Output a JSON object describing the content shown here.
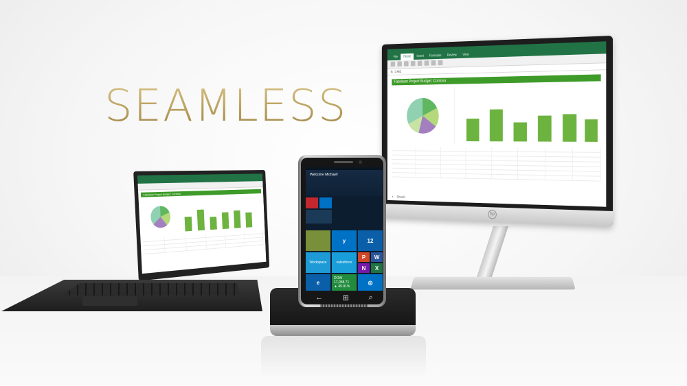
{
  "headline": "SEAMLESS",
  "monitor": {
    "sheet_title": "Fabrikam Project Budget: Contoso",
    "tabs": [
      "File",
      "Home",
      "Insert",
      "Formulas",
      "Review",
      "View"
    ],
    "active_tab": "Home",
    "formula_value": "1,463",
    "sheet_tab": "Sheet1"
  },
  "laptop": {
    "sheet_title": "Fabrikam Project Budget: Contoso"
  },
  "phone": {
    "lock_message": "Welcome Michael!",
    "tiles": {
      "yammer": "y",
      "outlook_count": "12",
      "workspace": "Workspace",
      "salesforce": "salesforce",
      "stocks_name": "DOW",
      "stocks_value": "17,058.71",
      "stocks_change": "▲ 45.91%"
    }
  },
  "colors": {
    "excel_green": "#217346",
    "chart_green": "#6db33f",
    "headline_gold": "#b9a05e"
  }
}
